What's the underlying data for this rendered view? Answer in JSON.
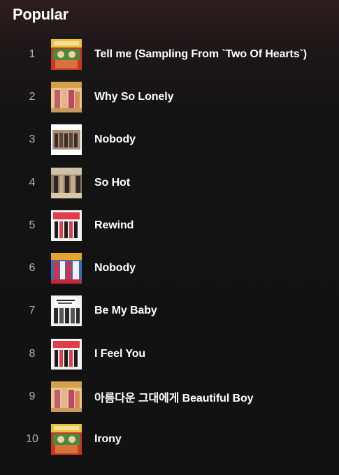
{
  "section": {
    "title": "Popular"
  },
  "tracks": [
    {
      "number": "1",
      "title": "Tell me (Sampling From `Two Of Hearts`)",
      "cover": "the-wonder-years-cover"
    },
    {
      "number": "2",
      "title": "Why So Lonely",
      "cover": "why-so-lonely-cover"
    },
    {
      "number": "3",
      "title": "Nobody",
      "cover": "nobody-bw-cover"
    },
    {
      "number": "4",
      "title": "So Hot",
      "cover": "so-hot-cover"
    },
    {
      "number": "5",
      "title": "Rewind",
      "cover": "reboot-cover"
    },
    {
      "number": "6",
      "title": "Nobody",
      "cover": "nobody-color-cover"
    },
    {
      "number": "7",
      "title": "Be My Baby",
      "cover": "wonder-world-cover"
    },
    {
      "number": "8",
      "title": "I Feel You",
      "cover": "reboot-cover"
    },
    {
      "number": "9",
      "title": "아름다운 그대에게 Beautiful Boy",
      "cover": "why-so-lonely-cover"
    },
    {
      "number": "10",
      "title": "Irony",
      "cover": "the-wonder-years-cover"
    }
  ]
}
